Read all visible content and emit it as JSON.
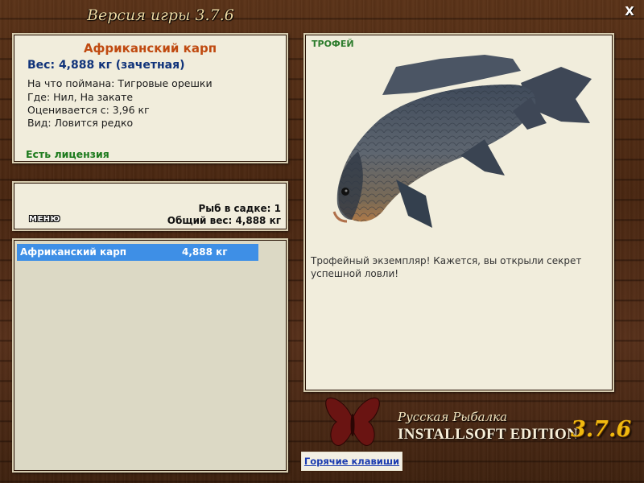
{
  "window": {
    "title": "Версия игры 3.7.6",
    "close_label": "X"
  },
  "fish_info": {
    "name": "Африканский карп",
    "weight": "Вес: 4,888 кг (зачетная)",
    "caught_with": "На что поймана: Тигровые орешки",
    "location": "Где: Нил, На закате",
    "rated_from": "Оценивается с: 3,96 кг",
    "rarity": "Вид: Ловится редко",
    "license": "Есть лицензия"
  },
  "stats": {
    "fish_in_net": "Рыб в садке: 1",
    "total_weight": "Общий вес: 4,888 кг",
    "menu_label": "МЕНЮ"
  },
  "catch_list": [
    {
      "name": "Африканский карп",
      "weight": "4,888 кг",
      "selected": true
    }
  ],
  "detail": {
    "label": "ТРОФЕЙ",
    "picture_icon": "carp-fish-icon",
    "text": "Трофейный экземпляр! Кажется, вы открыли секрет успешной ловли!"
  },
  "logo": {
    "icon": "butterfly-icon",
    "line1": "Русская Рыбалка",
    "line2": "INSTALLSOFT EDITION",
    "version": "3.7.6"
  },
  "hotkeys_label": "Горячие клавиши",
  "colors": {
    "fish_name": "#c04a10",
    "weight": "#10337a",
    "license": "#1c7a1c",
    "selection": "#3e8fe6",
    "version_gold": "#f1b90f"
  }
}
